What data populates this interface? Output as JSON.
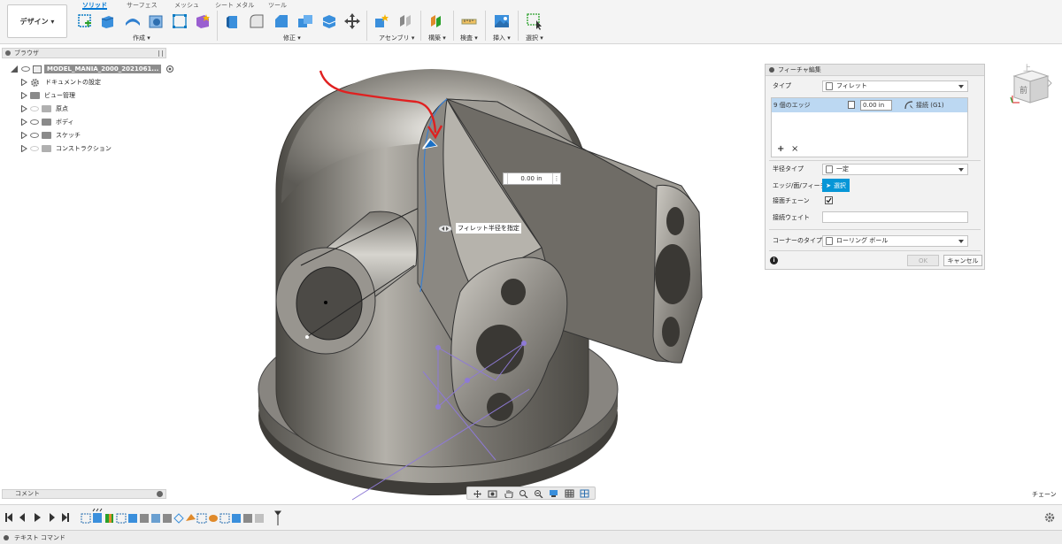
{
  "toolbar": {
    "workspace_label": "デザイン ▾",
    "tabs": [
      "ソリッド",
      "サーフェス",
      "メッシュ",
      "シート メタル",
      "ツール"
    ],
    "active_tab": "ソリッド",
    "groups": [
      "作成 ▾",
      "修正 ▾",
      "アセンブリ ▾",
      "構築 ▾",
      "検査 ▾",
      "挿入 ▾",
      "選択 ▾"
    ]
  },
  "browser": {
    "title": "ブラウザ",
    "root_label": "MODEL_MANIA_2000_2021061...",
    "items": [
      {
        "label": "ドキュメントの設定"
      },
      {
        "label": "ビュー管理"
      },
      {
        "label": "原点"
      },
      {
        "label": "ボディ"
      },
      {
        "label": "スケッチ"
      },
      {
        "label": "コンストラクション"
      }
    ]
  },
  "comments": {
    "label": "コメント"
  },
  "viewport": {
    "radius_input_value": "0.00 in",
    "fillet_tooltip": "フィレット半径を指定",
    "chain_label": "チェーン",
    "viewcube_top": "上",
    "viewcube_front": "前"
  },
  "dialog": {
    "title": "フィーチャ編集",
    "type_label": "タイプ",
    "type_value": "フィレット",
    "edge_count_label": "9 個のエッジ",
    "edge_radius_value": "0.00 in",
    "edge_continuity": "接続 (G1)",
    "add_symbol": "+",
    "remove_symbol": "×",
    "radius_type_label": "半径タイプ",
    "radius_type_value": "一定",
    "edge_face_label": "エッジ/面/フィーチャ",
    "select_button": "選択",
    "tangent_chain_label": "接面チェーン",
    "tangent_weight_label": "接続ウェイト",
    "corner_type_label": "コーナーのタイプ",
    "corner_type_value": "ローリング ボール",
    "ok_button": "OK",
    "cancel_button": "キャンセル"
  },
  "status": {
    "text_command_label": "テキスト コマンド"
  },
  "colors": {
    "accent": "#0696d7",
    "annotation_red": "#e02020",
    "annotation_orange": "#f26522"
  }
}
